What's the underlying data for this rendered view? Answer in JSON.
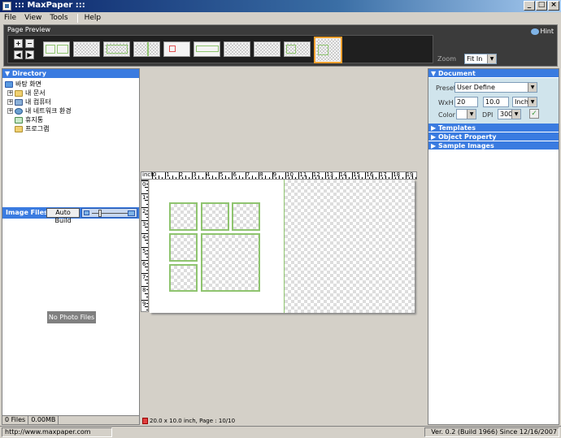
{
  "window": {
    "title": "::: MaxPaper :::"
  },
  "menu": {
    "file": "File",
    "view": "View",
    "tools": "Tools",
    "help": "Help"
  },
  "preview": {
    "label": "Page Preview",
    "hint": "Hint",
    "zoom_label": "Zoom",
    "zoom_value": "Fit In"
  },
  "directory": {
    "header": "Directory",
    "items": [
      {
        "label": "바탕 화면"
      },
      {
        "label": "내 문서"
      },
      {
        "label": "내 컴퓨터"
      },
      {
        "label": "내 네트워크 환경"
      },
      {
        "label": "휴지통"
      },
      {
        "label": "프로그램"
      }
    ]
  },
  "image_files": {
    "header": "Image Files",
    "auto_build": "Auto Build",
    "empty": "No Photo Files",
    "count": "0 Files",
    "size": "0.00MB"
  },
  "ruler": {
    "unit": "inch",
    "top": [
      "0",
      "1",
      "2",
      "3",
      "4",
      "5",
      "6",
      "7",
      "8",
      "9",
      "10",
      "11",
      "12",
      "13",
      "14",
      "15",
      "16",
      "17",
      "18",
      "19"
    ],
    "left": [
      "0",
      "1",
      "2",
      "3",
      "4",
      "5",
      "6",
      "7",
      "8",
      "9"
    ]
  },
  "canvas_status": "20.0 x 10.0 inch,  Page : 10/10",
  "document": {
    "header": "Document",
    "preset_label": "Preset",
    "preset_value": "User Define",
    "wxh_label": "WxH",
    "width": "20",
    "height": "10.0",
    "unit": "Inch",
    "color_label": "Color",
    "dpi_label": "DPI",
    "dpi_value": "300"
  },
  "sections": {
    "templates": "Templates",
    "object_property": "Object Property",
    "sample_images": "Sample Images"
  },
  "status": {
    "url": "http://www.maxpaper.com",
    "version": "Ver. 0.2 (Build 1966)  Since 12/16/2007"
  }
}
